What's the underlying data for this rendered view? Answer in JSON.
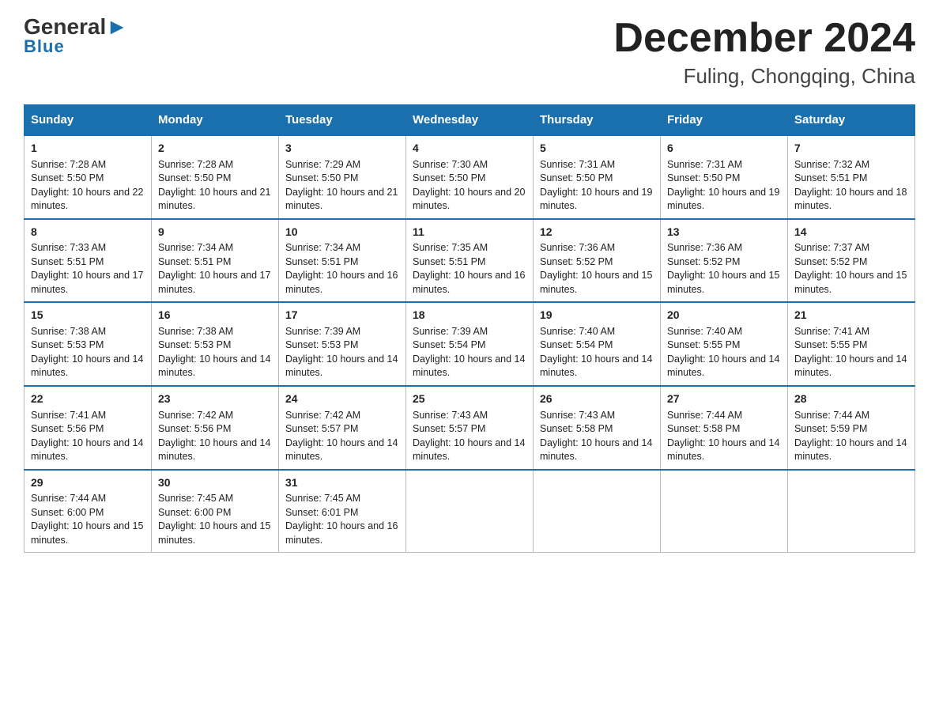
{
  "header": {
    "logo_general": "General",
    "logo_blue": "Blue",
    "month_title": "December 2024",
    "location": "Fuling, Chongqing, China"
  },
  "days_of_week": [
    "Sunday",
    "Monday",
    "Tuesday",
    "Wednesday",
    "Thursday",
    "Friday",
    "Saturday"
  ],
  "weeks": [
    [
      {
        "num": "1",
        "sunrise": "7:28 AM",
        "sunset": "5:50 PM",
        "daylight": "10 hours and 22 minutes."
      },
      {
        "num": "2",
        "sunrise": "7:28 AM",
        "sunset": "5:50 PM",
        "daylight": "10 hours and 21 minutes."
      },
      {
        "num": "3",
        "sunrise": "7:29 AM",
        "sunset": "5:50 PM",
        "daylight": "10 hours and 21 minutes."
      },
      {
        "num": "4",
        "sunrise": "7:30 AM",
        "sunset": "5:50 PM",
        "daylight": "10 hours and 20 minutes."
      },
      {
        "num": "5",
        "sunrise": "7:31 AM",
        "sunset": "5:50 PM",
        "daylight": "10 hours and 19 minutes."
      },
      {
        "num": "6",
        "sunrise": "7:31 AM",
        "sunset": "5:50 PM",
        "daylight": "10 hours and 19 minutes."
      },
      {
        "num": "7",
        "sunrise": "7:32 AM",
        "sunset": "5:51 PM",
        "daylight": "10 hours and 18 minutes."
      }
    ],
    [
      {
        "num": "8",
        "sunrise": "7:33 AM",
        "sunset": "5:51 PM",
        "daylight": "10 hours and 17 minutes."
      },
      {
        "num": "9",
        "sunrise": "7:34 AM",
        "sunset": "5:51 PM",
        "daylight": "10 hours and 17 minutes."
      },
      {
        "num": "10",
        "sunrise": "7:34 AM",
        "sunset": "5:51 PM",
        "daylight": "10 hours and 16 minutes."
      },
      {
        "num": "11",
        "sunrise": "7:35 AM",
        "sunset": "5:51 PM",
        "daylight": "10 hours and 16 minutes."
      },
      {
        "num": "12",
        "sunrise": "7:36 AM",
        "sunset": "5:52 PM",
        "daylight": "10 hours and 15 minutes."
      },
      {
        "num": "13",
        "sunrise": "7:36 AM",
        "sunset": "5:52 PM",
        "daylight": "10 hours and 15 minutes."
      },
      {
        "num": "14",
        "sunrise": "7:37 AM",
        "sunset": "5:52 PM",
        "daylight": "10 hours and 15 minutes."
      }
    ],
    [
      {
        "num": "15",
        "sunrise": "7:38 AM",
        "sunset": "5:53 PM",
        "daylight": "10 hours and 14 minutes."
      },
      {
        "num": "16",
        "sunrise": "7:38 AM",
        "sunset": "5:53 PM",
        "daylight": "10 hours and 14 minutes."
      },
      {
        "num": "17",
        "sunrise": "7:39 AM",
        "sunset": "5:53 PM",
        "daylight": "10 hours and 14 minutes."
      },
      {
        "num": "18",
        "sunrise": "7:39 AM",
        "sunset": "5:54 PM",
        "daylight": "10 hours and 14 minutes."
      },
      {
        "num": "19",
        "sunrise": "7:40 AM",
        "sunset": "5:54 PM",
        "daylight": "10 hours and 14 minutes."
      },
      {
        "num": "20",
        "sunrise": "7:40 AM",
        "sunset": "5:55 PM",
        "daylight": "10 hours and 14 minutes."
      },
      {
        "num": "21",
        "sunrise": "7:41 AM",
        "sunset": "5:55 PM",
        "daylight": "10 hours and 14 minutes."
      }
    ],
    [
      {
        "num": "22",
        "sunrise": "7:41 AM",
        "sunset": "5:56 PM",
        "daylight": "10 hours and 14 minutes."
      },
      {
        "num": "23",
        "sunrise": "7:42 AM",
        "sunset": "5:56 PM",
        "daylight": "10 hours and 14 minutes."
      },
      {
        "num": "24",
        "sunrise": "7:42 AM",
        "sunset": "5:57 PM",
        "daylight": "10 hours and 14 minutes."
      },
      {
        "num": "25",
        "sunrise": "7:43 AM",
        "sunset": "5:57 PM",
        "daylight": "10 hours and 14 minutes."
      },
      {
        "num": "26",
        "sunrise": "7:43 AM",
        "sunset": "5:58 PM",
        "daylight": "10 hours and 14 minutes."
      },
      {
        "num": "27",
        "sunrise": "7:44 AM",
        "sunset": "5:58 PM",
        "daylight": "10 hours and 14 minutes."
      },
      {
        "num": "28",
        "sunrise": "7:44 AM",
        "sunset": "5:59 PM",
        "daylight": "10 hours and 14 minutes."
      }
    ],
    [
      {
        "num": "29",
        "sunrise": "7:44 AM",
        "sunset": "6:00 PM",
        "daylight": "10 hours and 15 minutes."
      },
      {
        "num": "30",
        "sunrise": "7:45 AM",
        "sunset": "6:00 PM",
        "daylight": "10 hours and 15 minutes."
      },
      {
        "num": "31",
        "sunrise": "7:45 AM",
        "sunset": "6:01 PM",
        "daylight": "10 hours and 16 minutes."
      },
      null,
      null,
      null,
      null
    ]
  ]
}
